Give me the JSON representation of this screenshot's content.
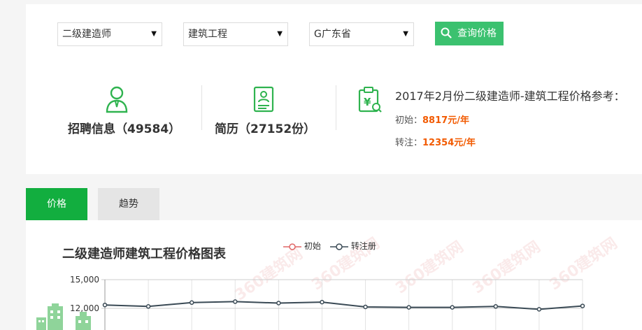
{
  "filters": {
    "qualification": "二级建造师",
    "major": "建筑工程",
    "region": "G广东省",
    "arrow": "▼"
  },
  "search_button": {
    "label": "查询价格",
    "icon": "search-icon"
  },
  "stats": {
    "jobs_label": "招聘信息（49584）",
    "resumes_label": "简历（27152份）"
  },
  "price_ref": {
    "title": "2017年2月份二级建造师-建筑工程价格参考：",
    "initial_label": "初始：",
    "initial_value": "8817元/年",
    "transfer_label": "转注：",
    "transfer_value": "12354元/年"
  },
  "tabs": [
    {
      "label": "价格",
      "active": true
    },
    {
      "label": "趋势",
      "active": false
    }
  ],
  "watermark_text": "360建筑网",
  "chart_data": {
    "type": "line",
    "title": "二级建造师建筑工程价格图表",
    "y_ticks": [
      "15,000",
      "12,000"
    ],
    "ylim": [
      9000,
      15000
    ],
    "series": [
      {
        "name": "初始",
        "color": "#e06666",
        "values": []
      },
      {
        "name": "转注册",
        "color": "#3a4a55",
        "values": [
          12350,
          12200,
          12600,
          12700,
          12550,
          12650,
          12150,
          12100,
          12100,
          12200,
          11900,
          12250
        ]
      }
    ],
    "grid": true
  }
}
